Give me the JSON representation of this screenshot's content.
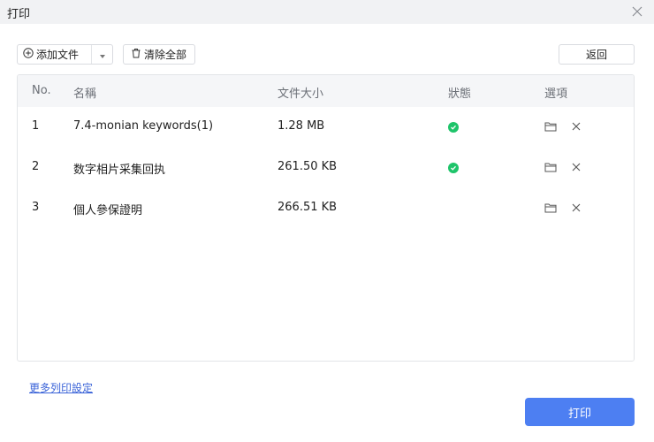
{
  "window": {
    "title": "打印"
  },
  "toolbar": {
    "add_file_label": "添加文件",
    "clear_all_label": "清除全部",
    "back_label": "返回"
  },
  "table": {
    "headers": {
      "no": "No.",
      "name": "名稱",
      "size": "文件大小",
      "status": "狀態",
      "options": "選項"
    },
    "rows": [
      {
        "no": "1",
        "name": "7.4-monian keywords(1)",
        "size": "1.28 MB",
        "status": "ok"
      },
      {
        "no": "2",
        "name": "数字相片采集回执",
        "size": "261.50 KB",
        "status": "ok"
      },
      {
        "no": "3",
        "name": "個人參保證明",
        "size": "266.51 KB",
        "status": ""
      }
    ]
  },
  "footer": {
    "more_settings_link": "更多列印設定",
    "print_label": "打印"
  },
  "icons": {
    "add": "plus-circle-icon",
    "dropdown": "caret-down-icon",
    "clear": "trash-icon",
    "close": "close-icon",
    "status_ok": "check-circle-icon",
    "folder": "folder-icon",
    "delete": "close-icon"
  },
  "colors": {
    "accent": "#4d7ff2",
    "success": "#1ec46a",
    "link": "#3a63d8",
    "titlebar": "#f1f2f4",
    "header_bg": "#f5f6f8"
  }
}
